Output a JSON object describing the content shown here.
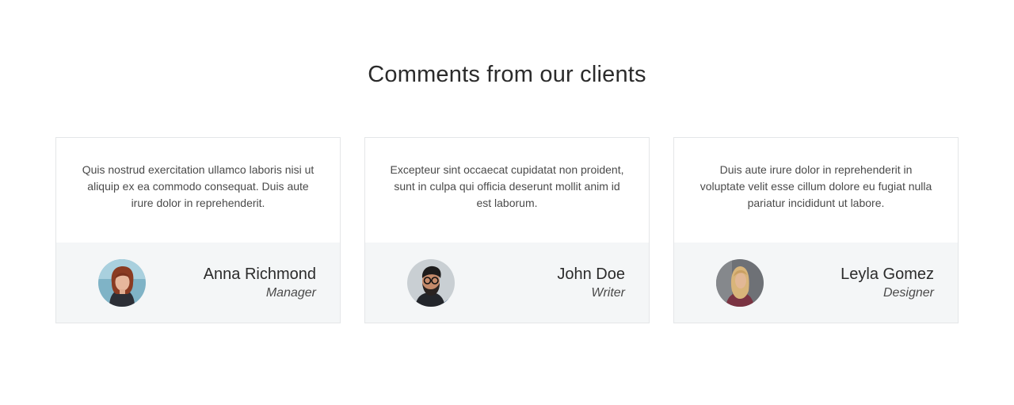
{
  "section": {
    "title": "Comments from our clients"
  },
  "testimonials": [
    {
      "quote": "Quis nostrud exercitation ullamco laboris nisi ut aliquip ex ea commodo consequat. Duis aute irure dolor in reprehenderit.",
      "name": "Anna Richmond",
      "role": "Manager",
      "avatar_icon": "avatar-photo-woman-red-hair"
    },
    {
      "quote": "Excepteur sint occaecat cupidatat non proident, sunt in culpa qui officia deserunt mollit anim id est laborum.",
      "name": "John Doe",
      "role": "Writer",
      "avatar_icon": "avatar-photo-man-glasses-beard"
    },
    {
      "quote": "Duis aute irure dolor in reprehenderit in voluptate velit esse cillum dolore eu fugiat nulla pariatur incididunt ut labore.",
      "name": "Leyla Gomez",
      "role": "Designer",
      "avatar_icon": "avatar-photo-woman-blonde"
    }
  ],
  "colors": {
    "card_border": "#e4e6e8",
    "card_footer_bg": "#f4f6f7",
    "title_text": "#2b2b2b",
    "body_text": "#4a4a4a"
  }
}
